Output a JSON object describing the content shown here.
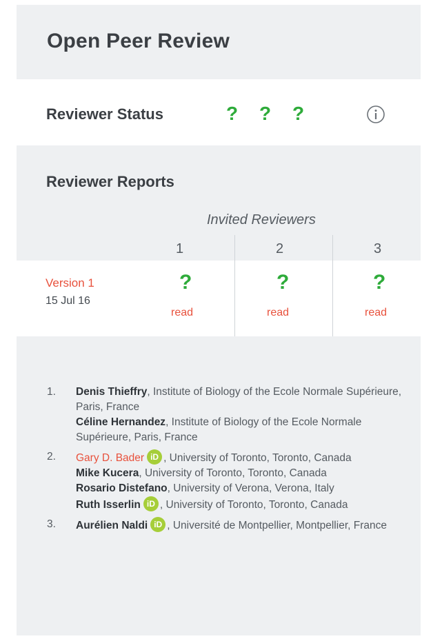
{
  "header": {
    "title": "Open Peer Review"
  },
  "status": {
    "label": "Reviewer Status",
    "icons": [
      "?",
      "?",
      "?"
    ],
    "info_icon": "info-icon"
  },
  "reports": {
    "label": "Reviewer Reports",
    "invited_label": "Invited Reviewers",
    "columns": [
      "1",
      "2",
      "3"
    ],
    "versions": [
      {
        "label": "Version 1",
        "date": "15 Jul 16",
        "cells": [
          {
            "status": "?",
            "link": "read"
          },
          {
            "status": "?",
            "link": "read"
          },
          {
            "status": "?",
            "link": "read"
          }
        ]
      }
    ]
  },
  "reviewers": [
    {
      "num": "1.",
      "people": [
        {
          "name": "Denis Thieffry",
          "affil": ", Institute of Biology of the Ecole Normale Supérieure, Paris, France"
        },
        {
          "name": "Céline Hernandez",
          "affil": ", Institute of Biology of the Ecole Normale Supérieure, Paris, France"
        }
      ]
    },
    {
      "num": "2.",
      "people": [
        {
          "name": "Gary D. Bader",
          "orcid": "iD",
          "affil": ", University of Toronto, Toronto, Canada"
        },
        {
          "name": "Mike Kucera",
          "affil": ", University of Toronto, Toronto, Canada"
        },
        {
          "name": "Rosario Distefano",
          "affil": ", University of Verona, Verona, Italy"
        },
        {
          "name": "Ruth Isserlin",
          "orcid": "iD",
          "affil": ", University of Toronto, Toronto, Canada"
        }
      ]
    },
    {
      "num": "3.",
      "people": [
        {
          "name": "Aurélien Naldi",
          "orcid": "iD",
          "affil": ", Université de Montpellier, Montpellier, France"
        }
      ]
    }
  ],
  "colors": {
    "accent_red": "#e8513c",
    "status_green": "#2eab3a",
    "orcid_green": "#a6ce39",
    "panel_bg": "#eef0f2"
  }
}
